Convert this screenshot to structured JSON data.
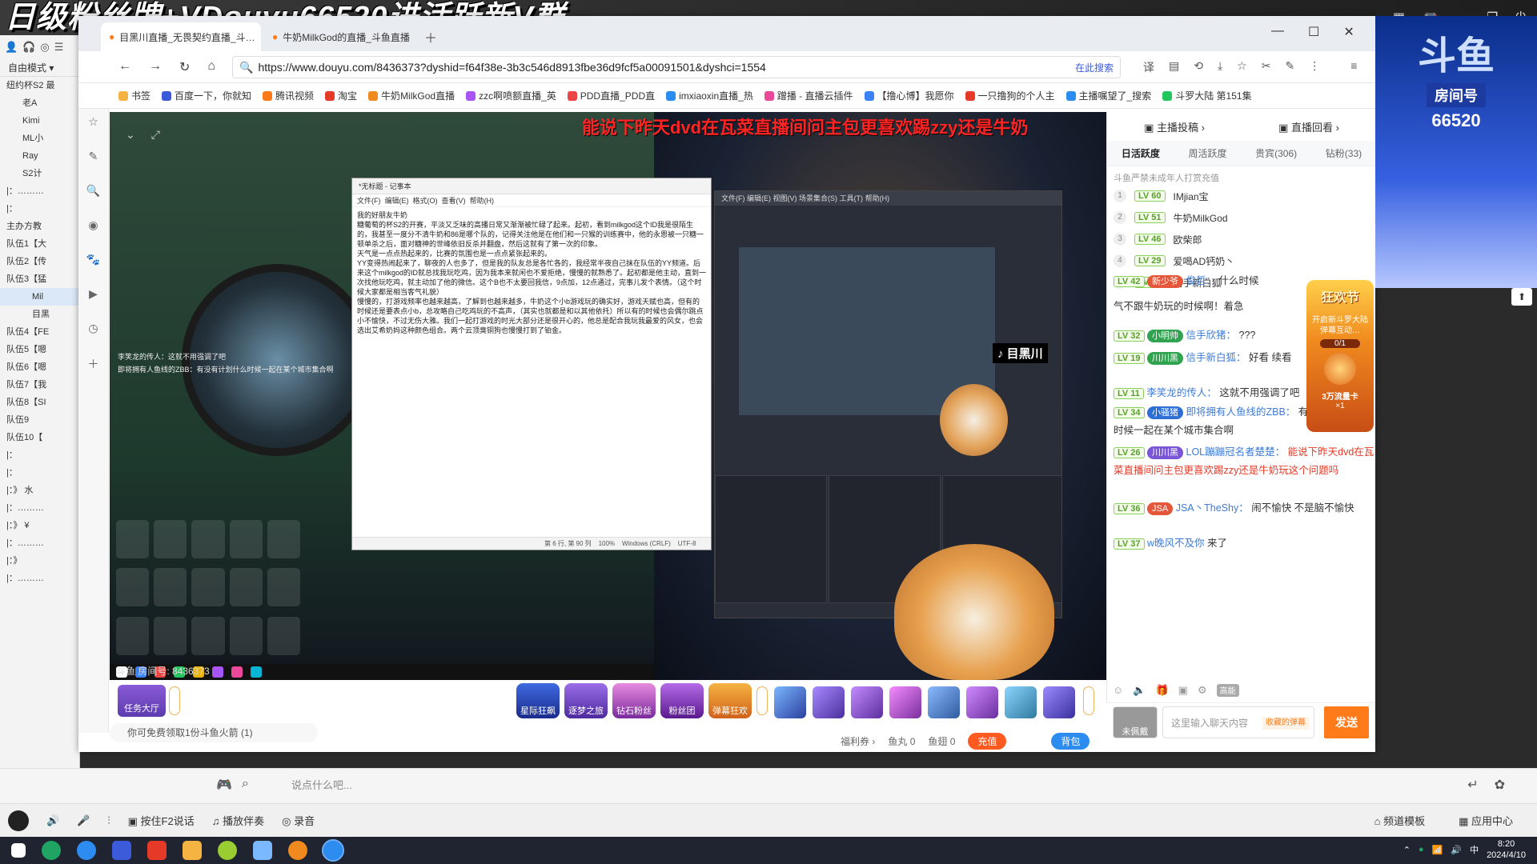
{
  "banner": {
    "text": "日级粉丝牌+VDouyu66520进活跃新V群"
  },
  "yy": {
    "mode": "自由模式",
    "tree": [
      "纽约杯S2 最",
      "老A",
      "Kimi",
      "ML小",
      "Ray",
      "S2计",
      "|：………",
      "|：",
      "主办方教",
      "队伍1【大",
      "队伍2【传",
      "队伍3【猛",
      "Mil",
      "目黑",
      "队伍4【FE",
      "队伍5【嗯",
      "队伍6【嗯",
      "队伍7【我",
      "队伍8【SI",
      "队伍9",
      "队伍10【",
      "|：",
      "|：",
      "|：》 水",
      "|：………",
      "|：》 ¥",
      "|：………",
      "|：》",
      "|：………"
    ],
    "say_placeholder": "说点什么吧...",
    "controls": [
      "按住F2说话",
      "播放伴奏",
      "录音"
    ],
    "right_controls": [
      "频道模板",
      "应用中心"
    ]
  },
  "browser": {
    "tabs": [
      "目黑川直播_无畏契约直播_斗…",
      "牛奶MilkGod的直播_斗鱼直播"
    ],
    "url": "https://www.douyu.com/8436373?dyshid=f64f38e-3b3c546d8913fbe36d9fcf5a00091501&dyshci=1554",
    "search_label": "在此搜索",
    "bookmarks": [
      "书签",
      "百度一下，你就知",
      "腾讯视频",
      "淘宝",
      "牛奶MilkGod直播",
      "zzc啊喷额直播_英",
      "PDD直播_PDD直",
      "imxiaoxin直播_热",
      "蹭播 - 直播云插件",
      "【撸心博】我愿你",
      "一只撸狗的个人主",
      "主播嘱望了_搜索",
      "斗罗大陆 第151集"
    ]
  },
  "stream": {
    "marquee": "能说下昨天dvd在瓦菜直播间问主包更喜欢踢zzy还是牛奶",
    "room_overlay": "斗鱼 房间号: 8436373",
    "tiktok_tag": "目黑川",
    "notepad": {
      "title": "*无标题 - 记事本",
      "menus": [
        "文件(F)",
        "编辑(E)",
        "格式(O)",
        "查看(V)",
        "帮助(H)"
      ],
      "body": "我的好朋友牛奶\n糖葡萄的杯S2的开赛，平淡又乏味的高播日常又渐渐被忙碌了起来。起初，看到milkgod这个ID我是很陌生的，我甚至一度分不清牛奶和86是哪个队的，记得关注他是在他们和一只猴的训练赛中，他的永恩被一只糖一顿单杀之后，面对糖神的世峰依旧反杀并翻盘，然后这就有了第一次的印象。\n天气是一点点热起来的，比赛的氛围也是一点点紧张起来的。\nYY变得热闹起来了，聊夜的人也多了，但是我的队友总是各忙各的，我经常半夜自己抹在队伍的YY频道。后来这个milkgod的ID就总找我玩吃鸡，因为我本来就闲也不爱拒绝，慢慢的就熟悉了。起初都是他主动，直到一次找他玩吃鸡，就主动加了他的微信。这个B也不太要回我信，9点加，12点通过，完事儿发个表情。（这个时候大家都是相当客气礼貌）\n慢慢的，打游戏频率也越来越高，了解到也越来越多，牛奶这个小b游戏玩的确实好，游戏天赋也高，但有的时候还是要表点小b，总攻略自己吃鸡玩的不高声，（其实也就都是和以其他依托）所以有的时候也会偶尔跳点小不愉快，不过无伤大雅。我们一起打游戏的时光大部分还是很开心的，他总是配合我玩我最爱的风女，也会选出艾希奶妈这种颜色组合。两个云顶臭铜狗也慢慢打到了铂金。",
      "status": [
        "第 6 行, 第 90 列",
        "100%",
        "Windows (CRLF)",
        "UTF-8"
      ]
    },
    "obs_menus": [
      "文件(F)",
      "编辑(E)",
      "视图(V)",
      "场景集合(S)",
      "工具(T)",
      "帮助(H)"
    ],
    "chat_overlay": [
      "李笑龙的传人：这就不用强调了吧",
      "即将拥有人鱼线的ZBB：有没有计划什么时候一起在某个城市集合啊"
    ]
  },
  "gift_bar": {
    "task_label": "任务大厅",
    "gifts": [
      "星际狂飙",
      "逐梦之旅",
      "钻石粉丝",
      "粉丝团",
      "弹幕狂欢"
    ],
    "free_gift": "你可免费领取1份斗鱼火箭 (1)",
    "welfare": "福利券",
    "fish_balls": "鱼丸 0",
    "fish_wings": "鱼翅 0",
    "recharge": "充值",
    "backpack": "背包"
  },
  "chat": {
    "top_links": [
      "主播投稿",
      "直播回看"
    ],
    "tabs": [
      "日活跃度",
      "周活跃度",
      "贵宾(306)",
      "钻粉(33)"
    ],
    "rank_note": "斗鱼严禁未成年人打赏充值",
    "rank": [
      {
        "no": "1",
        "lv": "LV 60",
        "name": "IMjian宝"
      },
      {
        "no": "2",
        "lv": "LV 51",
        "name": "牛奶MilkGod"
      },
      {
        "no": "3",
        "lv": "LV 46",
        "name": "欧柴郎"
      },
      {
        "no": "4",
        "lv": "LV 29",
        "name": "爱喝AD钙奶丶"
      },
      {
        "no": "5",
        "lv": "LV 19",
        "name": "信手新白狐"
      }
    ],
    "messages": [
      {
        "lv": "LV 42",
        "badge": "新少爷",
        "name": "俊哲：",
        "text": "什么时候"
      },
      {
        "lv": "",
        "badge": "",
        "name": "",
        "text": "气不跟牛奶玩的时候啊！着急"
      },
      {
        "lv": "LV 32",
        "badge": "小明帅",
        "name": "信手欣猪：",
        "text": "???"
      },
      {
        "lv": "LV 19",
        "badge": "川川黑",
        "name": "信手新白狐：",
        "text": "好看 续看"
      },
      {
        "lv": "LV 11",
        "badge": "",
        "name": "李笑龙的传人：",
        "text": "这就不用强调了吧"
      },
      {
        "lv": "LV 34",
        "badge": "小骚猪",
        "name": "即将拥有人鱼线的ZBB：",
        "text": "有没有计划什么时候一起在某个城市集合啊"
      },
      {
        "lv": "LV 26",
        "badge": "川川黑",
        "name": "LOL蹦蹦冠名者楚楚：",
        "text": "能说下昨天dvd在瓦菜直播间问主包更喜欢踢zzy还是牛奶玩这个问题吗"
      },
      {
        "lv": "LV 36",
        "badge": "JSA",
        "name": "JSA丶TheShy：",
        "text": "闹不愉快 不是脑不愉快"
      },
      {
        "lv": "LV 37",
        "badge": "",
        "name": "w晚风不及你",
        "text": "来了"
      }
    ],
    "input_placeholder": "这里输入聊天内容",
    "input_hint": "收藏的弹幕",
    "send": "发送",
    "unworn": "未佩戴",
    "shield": "高能"
  },
  "event_widget": {
    "title": "狂欢节",
    "line1": "开启新斗罗大陆弹幕互动…",
    "progress": "0/1",
    "reward": "3万流量卡",
    "count": "×1"
  },
  "poster": {
    "big": "斗鱼",
    "tag": "房间号",
    "room": "66520"
  },
  "tray": {
    "time": "8:20",
    "date": "2024/4/10",
    "ime": "中"
  },
  "colors": {
    "accent": "#ff7b1a",
    "lv": "#5aa02c",
    "name": "#3e7bd6",
    "red": "#e53a27"
  }
}
